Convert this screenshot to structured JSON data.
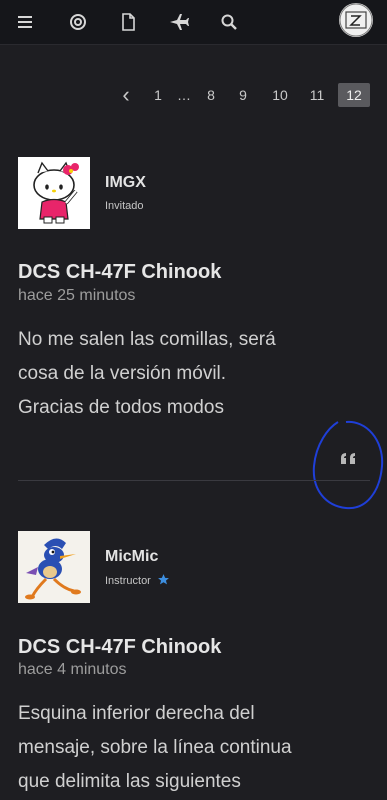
{
  "nav": {
    "icons": [
      "menu-icon",
      "target-icon",
      "document-icon",
      "airplane-icon",
      "search-icon",
      "user-avatar"
    ]
  },
  "pagination": {
    "prev": "‹",
    "pages": [
      "1",
      "…",
      "8",
      "9",
      "10",
      "11",
      "12"
    ],
    "current": "12"
  },
  "posts": [
    {
      "username": "IMGX",
      "role": "Invitado",
      "title": "DCS CH-47F Chinook",
      "time": "hace 25 minutos",
      "body": [
        "No me salen las comillas, será",
        "cosa de la versión móvil.",
        "Gracias de todos modos"
      ],
      "quote_icon": "quote-icon"
    },
    {
      "username": "MicMic",
      "role": "Instructor",
      "role_badge": "star-icon",
      "title": "DCS CH-47F Chinook",
      "time": "hace 4 minutos",
      "body": [
        "Esquina inferior derecha del",
        "mensaje, sobre la línea continua",
        "que delimita las siguientes"
      ]
    }
  ],
  "colors": {
    "background": "#1e1e22",
    "topbar": "#15161a",
    "current_page": "#5a5a5e",
    "annotation_circle": "#1f3fd8",
    "star": "#3d8fe0"
  }
}
